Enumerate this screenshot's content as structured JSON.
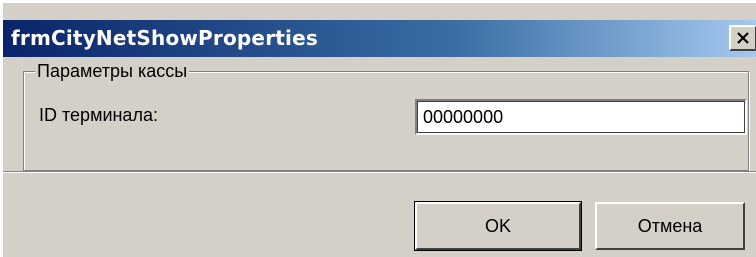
{
  "window": {
    "title": "frmCityNetShowProperties",
    "close_icon": "close-icon"
  },
  "groupbox": {
    "legend": "Параметры кассы",
    "terminal_label": "ID терминала:",
    "terminal_value": "00000000"
  },
  "buttons": {
    "ok_label": "OK",
    "cancel_label": "Отмена"
  },
  "colors": {
    "title_gradient_start": "#0a246a",
    "title_gradient_end": "#a6caf0",
    "face": "#d4d0c8"
  }
}
